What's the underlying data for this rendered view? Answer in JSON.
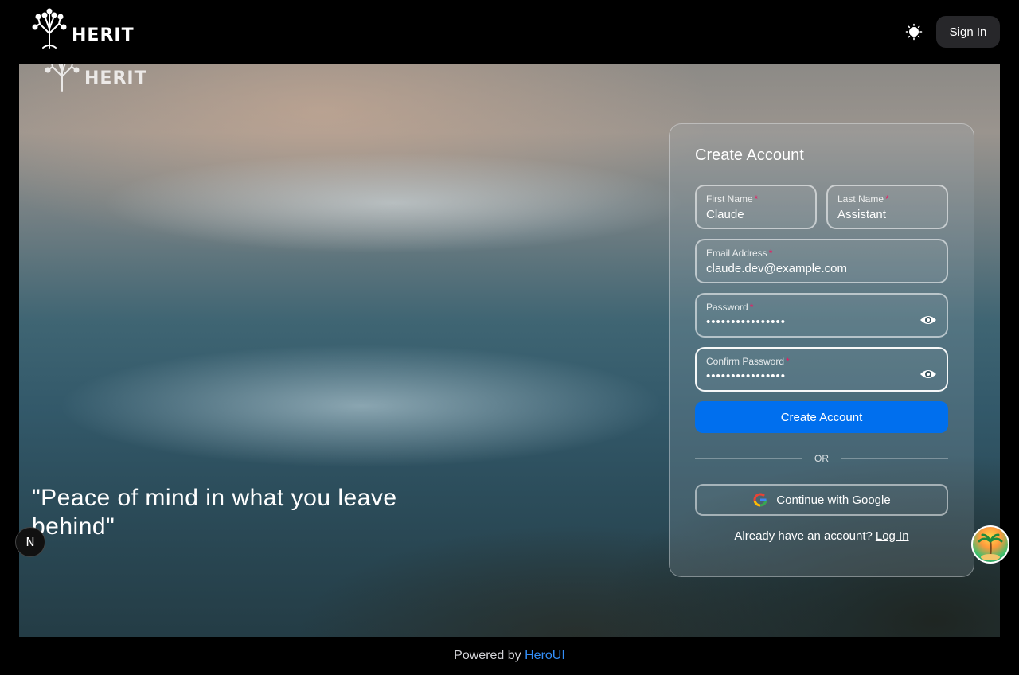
{
  "header": {
    "logo_text": "HERIT",
    "theme_toggle_icon": "sun-icon",
    "signin_label": "Sign In"
  },
  "hero": {
    "logo_text": "HERIT",
    "quote": "\"Peace of mind in what you leave behind\""
  },
  "form": {
    "title": "Create Account",
    "first_name": {
      "label": "First Name",
      "value": "Claude"
    },
    "last_name": {
      "label": "Last Name",
      "value": "Assistant"
    },
    "email": {
      "label": "Email Address",
      "value": "claude.dev@example.com"
    },
    "password": {
      "label": "Password",
      "value": "••••••••••••••••"
    },
    "confirm_password": {
      "label": "Confirm Password",
      "value": "••••••••••••••••"
    },
    "required_mark": "*",
    "submit_label": "Create Account",
    "divider_text": "OR",
    "google_label": "Continue with Google",
    "already_text": "Already have an account?",
    "login_link": "Log In"
  },
  "floating": {
    "n_badge": "N"
  },
  "footer": {
    "prefix": "Powered by",
    "brand": "HeroUI"
  },
  "colors": {
    "primary": "#006fee",
    "required": "#f31260",
    "brand_link": "#338ef7"
  }
}
